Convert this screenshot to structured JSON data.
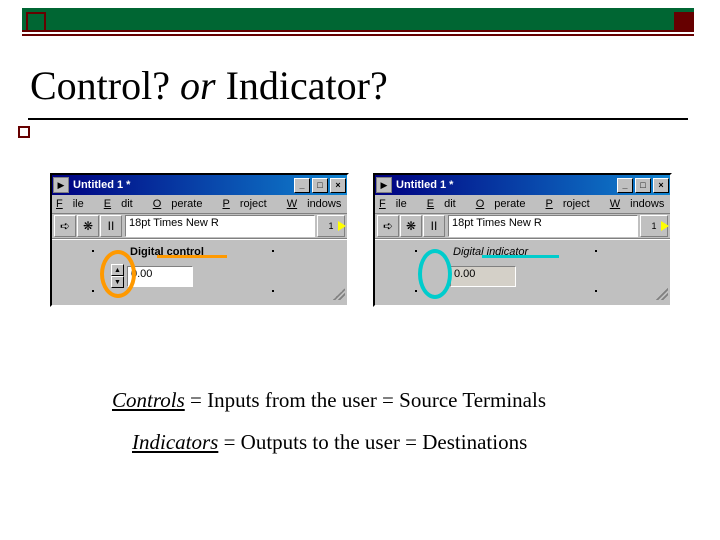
{
  "title": {
    "word1": "Control?",
    "or": "or",
    "word2": "Indicator?"
  },
  "body": {
    "line1_u": "Controls",
    "line1_rest": " = Inputs from the user = Source Terminals",
    "line2_u": "Indicators",
    "line2_rest": " = Outputs to the user = Destinations"
  },
  "menu": {
    "file": "F",
    "file_rest": "ile",
    "edit": "E",
    "edit_rest": "dit",
    "operate": "O",
    "operate_rest": "perate",
    "project": "P",
    "project_rest": "roject",
    "windows": "W",
    "windows_rest": "indows"
  },
  "window": {
    "appicon": "▶",
    "title_left": "Untitled 1 *",
    "title_right": "Untitled 1 *",
    "btn_min": "_",
    "btn_max": "□",
    "btn_close": "×",
    "font": "18pt Times New R",
    "pause": "II",
    "counter": "1"
  },
  "left": {
    "caption": "Digital control",
    "value": "0.00"
  },
  "right": {
    "caption": "Digital indicator",
    "value": "0.00"
  },
  "spin": {
    "up": "▲",
    "dn": "▼"
  }
}
